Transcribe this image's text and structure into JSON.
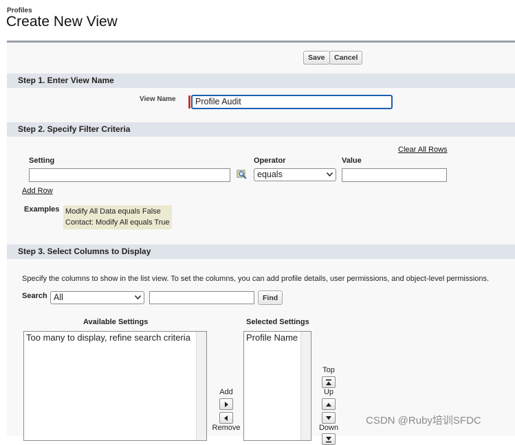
{
  "breadcrumb": "Profiles",
  "page_title": "Create New View",
  "toolbar": {
    "save_label": "Save",
    "cancel_label": "Cancel"
  },
  "step1": {
    "title": "Step 1. Enter View Name",
    "view_name_label": "View Name",
    "view_name_value": "Profile Audit"
  },
  "step2": {
    "title": "Step 2. Specify Filter Criteria",
    "clear_all_rows": "Clear All Rows",
    "setting_label": "Setting",
    "operator_label": "Operator",
    "value_label": "Value",
    "setting_value": "",
    "operator_value": "equals",
    "value_value": "",
    "add_row": "Add Row",
    "examples_label": "Examples",
    "examples": [
      "Modify All Data equals False",
      "Contact: Modify All equals True"
    ]
  },
  "step3": {
    "title": "Step 3. Select Columns to Display",
    "description": "Specify the columns to show in the list view. To set the columns, you can add profile details, user permissions, and object-level permissions.",
    "search_label": "Search",
    "search_select_value": "All",
    "search_text": "",
    "find_label": "Find",
    "available_label": "Available Settings",
    "available_items": [
      "Too many to display, refine search criteria"
    ],
    "selected_label": "Selected Settings",
    "selected_items": [
      "Profile Name"
    ],
    "add_label": "Add",
    "remove_label": "Remove",
    "top_label": "Top",
    "up_label": "Up",
    "down_label": "Down"
  },
  "watermark": "CSDN @Ruby培训SFDC",
  "colors": {
    "required_marker": "#c23934",
    "focus_border": "#1b5fb0",
    "section_header": "#dfe3ea",
    "example_bg": "#ebe9d0"
  }
}
